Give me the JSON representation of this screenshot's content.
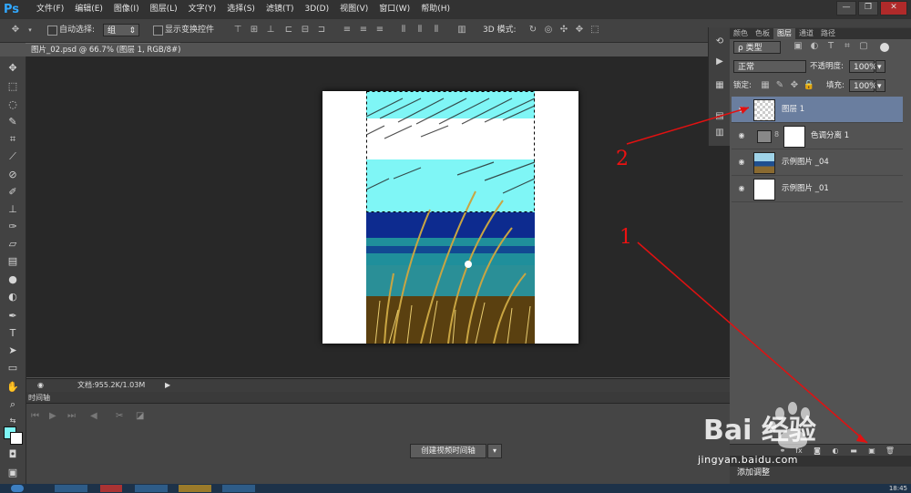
{
  "app": {
    "logo": "Ps"
  },
  "menu": [
    "文件(F)",
    "编辑(E)",
    "图像(I)",
    "图层(L)",
    "文字(Y)",
    "选择(S)",
    "滤镜(T)",
    "3D(D)",
    "视图(V)",
    "窗口(W)",
    "帮助(H)"
  ],
  "window_controls": {
    "minimize": "—",
    "restore": "❐",
    "close": "✕"
  },
  "options": {
    "auto_select_label": "自动选择:",
    "auto_select_value": "组",
    "show_transform_label": "显示变换控件",
    "mode_3d_label": "3D 模式:"
  },
  "document": {
    "tab_title": "图片_02.psd @ 66.7% (图层 1, RGB/8#) *"
  },
  "statusbar": {
    "zoom": "",
    "doc_info": "文档:955.2K/1.03M"
  },
  "timeline": {
    "title": "时间轴",
    "create_button": "创建视频时间轴"
  },
  "panels": {
    "tabs": [
      "颜色",
      "色板",
      "图层",
      "通道",
      "路径"
    ],
    "active_tab": "图层",
    "filter_kind": "ρ 类型",
    "blend_mode": "正常",
    "opacity_label": "不透明度:",
    "opacity_value": "100%",
    "lock_label": "锁定:",
    "fill_label": "填充:",
    "fill_value": "100%"
  },
  "layers": [
    {
      "name": "图层 1",
      "selected": true
    },
    {
      "name": "色调分离 1",
      "selected": false
    },
    {
      "name": "示例图片 _04",
      "selected": false
    },
    {
      "name": "示例图片 _01",
      "selected": false
    }
  ],
  "adjustments": {
    "label": "添加调整"
  },
  "annotations": {
    "marker_1": "1",
    "marker_2": "2"
  },
  "watermark": {
    "logo_text": "Bai 经验",
    "url": "jingyan.baidu.com"
  },
  "taskbar": {
    "clock": "18:45"
  },
  "colors": {
    "foreground": "#7ff6f6",
    "background": "#ffffff",
    "selected_layer": "#6a7e9f",
    "annotation": "#e11111"
  }
}
